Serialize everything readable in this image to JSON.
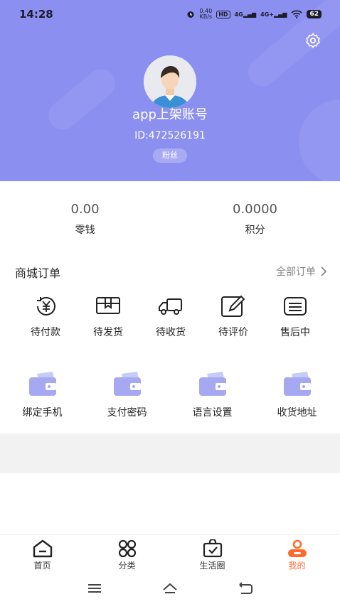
{
  "status_bar": {
    "time": "14:28",
    "net_speed": "0.40",
    "net_unit": "KB/s",
    "hd": "HD",
    "sim1": "4G",
    "sim2": "4G+",
    "battery": "62"
  },
  "profile": {
    "username": "app上架账号",
    "user_id": "ID:472526191",
    "badge": "粉丝"
  },
  "balances": [
    {
      "value": "0.00",
      "label": "零钱"
    },
    {
      "value": "0.0000",
      "label": "积分"
    }
  ],
  "orders": {
    "title": "商城订单",
    "all_label": "全部订单",
    "items": [
      {
        "label": "待付款",
        "icon": "yuan-coin-icon"
      },
      {
        "label": "待发货",
        "icon": "package-icon"
      },
      {
        "label": "待收货",
        "icon": "truck-icon"
      },
      {
        "label": "待评价",
        "icon": "edit-icon"
      },
      {
        "label": "售后中",
        "icon": "service-list-icon"
      }
    ]
  },
  "tools": [
    {
      "label": "绑定手机",
      "icon": "wallet-icon"
    },
    {
      "label": "支付密码",
      "icon": "wallet-icon"
    },
    {
      "label": "语言设置",
      "icon": "wallet-icon"
    },
    {
      "label": "收货地址",
      "icon": "wallet-icon"
    }
  ],
  "tabs": [
    {
      "label": "首页",
      "icon": "home-icon",
      "active": false
    },
    {
      "label": "分类",
      "icon": "category-icon",
      "active": false
    },
    {
      "label": "生活圈",
      "icon": "life-bag-icon",
      "active": false
    },
    {
      "label": "我的",
      "icon": "user-icon",
      "active": true
    }
  ],
  "colors": {
    "header_bg": "#8b8ff0",
    "accent": "#ff6a2c",
    "tool_icon": "#a6a9f2",
    "grey_band": "#f2f2f2"
  }
}
